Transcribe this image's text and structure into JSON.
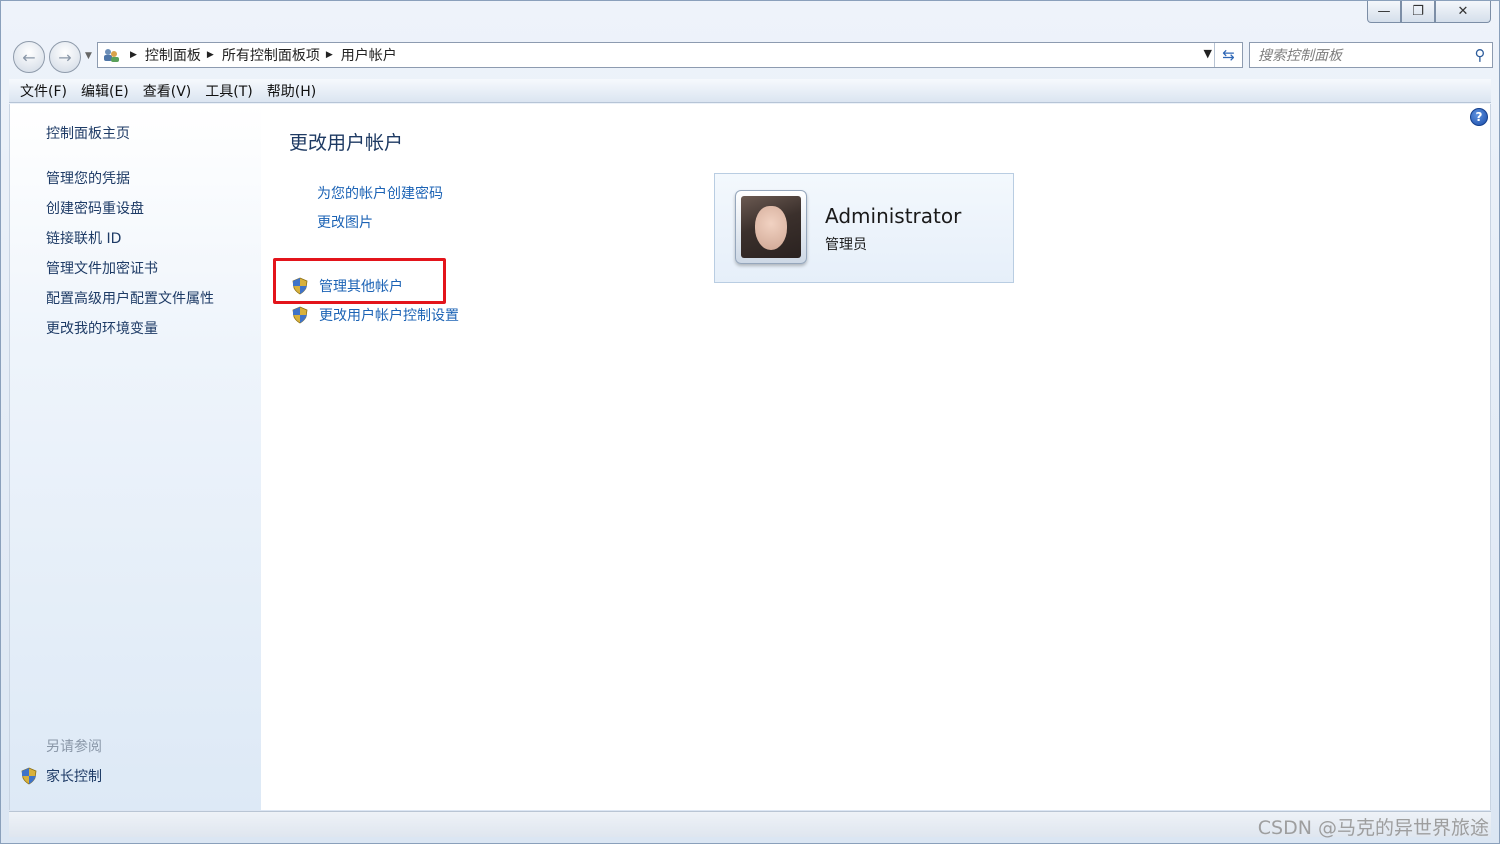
{
  "window": {
    "caption_buttons": [
      "minimize",
      "maximize",
      "close"
    ]
  },
  "navigation": {
    "breadcrumbs": [
      "控制面板",
      "所有控制面板项",
      "用户帐户"
    ],
    "search_placeholder": "搜索控制面板"
  },
  "menu": [
    "文件(F)",
    "编辑(E)",
    "查看(V)",
    "工具(T)",
    "帮助(H)"
  ],
  "sidebar": {
    "home": "控制面板主页",
    "links": [
      "管理您的凭据",
      "创建密码重设盘",
      "链接联机 ID",
      "管理文件加密证书",
      "配置高级用户配置文件属性",
      "更改我的环境变量"
    ],
    "see_also_title": "另请参阅",
    "see_also": [
      "家长控制"
    ]
  },
  "main": {
    "title": "更改用户帐户",
    "tasks": [
      "为您的帐户创建密码",
      "更改图片"
    ],
    "admin_tasks": [
      "管理其他帐户",
      "更改用户帐户控制设置"
    ],
    "highlighted_task": "管理其他帐户"
  },
  "user": {
    "name": "Administrator",
    "role": "管理员"
  },
  "watermark": "CSDN @马克的异世界旅途",
  "colors": {
    "link": "#1c63b5",
    "highlight_box": "#e3141b",
    "title": "#1e3a63"
  }
}
